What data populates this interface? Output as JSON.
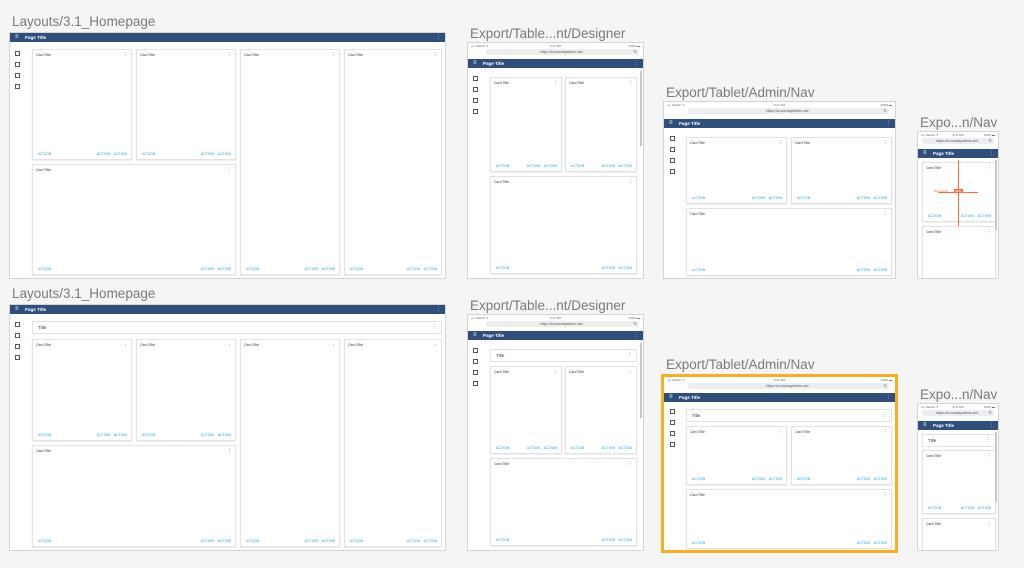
{
  "labels": {
    "homepage": "Layouts/3.1_Homepage",
    "designer": "Export/Table...nt/Designer",
    "admin": "Export/Tablet/Admin/Nav",
    "phone": "Expo...n/Nav"
  },
  "device": {
    "carrier": "•••• Sketch ✈",
    "time": "9:47 AM",
    "battery": "100% ▬",
    "url": "https://st.conwaystems.net/..",
    "refresh": "↻"
  },
  "app": {
    "menu_icon": "≡",
    "page_title": "Page Title",
    "more_icon": "⋮",
    "list_title": "Title"
  },
  "card": {
    "title": "Card Title",
    "action": "ACTION"
  },
  "annotation": {
    "text": "Bar Height",
    "badge": "24dp"
  }
}
